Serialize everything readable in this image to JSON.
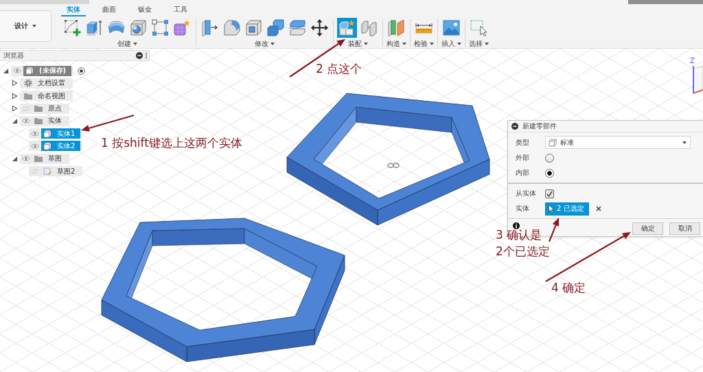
{
  "toolbar": {
    "workspace": "设计",
    "tabs": [
      {
        "label": "实体",
        "selected": true
      },
      {
        "label": "曲面",
        "selected": false
      },
      {
        "label": "钣金",
        "selected": false
      },
      {
        "label": "工具",
        "selected": false
      }
    ],
    "groups": [
      {
        "label": "创建",
        "tools": [
          {
            "kind": "sketch",
            "selected": false
          },
          {
            "kind": "extrude",
            "selected": false
          },
          {
            "kind": "revolve",
            "selected": false
          },
          {
            "kind": "hole",
            "selected": false
          },
          {
            "kind": "pattern",
            "selected": false
          },
          {
            "kind": "form",
            "selected": false
          }
        ]
      },
      {
        "label": "修改",
        "tools": [
          {
            "kind": "press_pull",
            "selected": false
          },
          {
            "kind": "fillet",
            "selected": false
          },
          {
            "kind": "shell",
            "selected": false
          },
          {
            "kind": "combine",
            "selected": false
          },
          {
            "kind": "offset",
            "selected": false
          },
          {
            "kind": "move",
            "selected": false
          }
        ]
      },
      {
        "label": "装配",
        "tools": [
          {
            "kind": "new_component",
            "selected": true
          },
          {
            "kind": "joint",
            "selected": false
          }
        ]
      },
      {
        "label": "构造",
        "tools": [
          {
            "kind": "plane",
            "selected": false
          }
        ]
      },
      {
        "label": "检验",
        "tools": [
          {
            "kind": "measure",
            "selected": false
          }
        ]
      },
      {
        "label": "插入",
        "tools": [
          {
            "kind": "image",
            "selected": false
          }
        ]
      },
      {
        "label": "选择",
        "tools": [
          {
            "kind": "select",
            "selected": false
          }
        ]
      }
    ]
  },
  "browser": {
    "title": "浏览器",
    "root": {
      "label": "(未保存)",
      "kind": "component",
      "active": true,
      "expanded": true,
      "visible": true,
      "selected": false,
      "children": [
        {
          "label": "文档设置",
          "kind": "settings",
          "expanded": false,
          "selected": false
        },
        {
          "label": "命名视图",
          "kind": "folder",
          "expanded": false,
          "selected": false
        },
        {
          "label": "原点",
          "kind": "folder",
          "expanded": false,
          "visible": false,
          "selected": false
        },
        {
          "label": "实体",
          "kind": "folder",
          "expanded": true,
          "visible": true,
          "selected": false,
          "children": [
            {
              "label": "实体1",
              "kind": "body",
              "visible": true,
              "selected": true
            },
            {
              "label": "实体2",
              "kind": "body",
              "visible": true,
              "selected": true
            }
          ]
        },
        {
          "label": "草图",
          "kind": "folder",
          "expanded": true,
          "visible": true,
          "selected": false,
          "children": [
            {
              "label": "草图2",
              "kind": "sketch",
              "visible": false,
              "selected": false
            }
          ]
        }
      ]
    }
  },
  "dialog": {
    "title": "新建零部件",
    "sections": [
      {
        "fields": [
          {
            "kind": "dropdown",
            "label": "类型",
            "value": "标准"
          },
          {
            "kind": "radio",
            "label": "外部",
            "selected": false
          },
          {
            "kind": "radio",
            "label": "内部",
            "selected": true
          }
        ]
      },
      {
        "fields": [
          {
            "kind": "checkbox",
            "label": "从实体",
            "checked": true
          },
          {
            "kind": "selection",
            "label": "实体",
            "value": "2 已选定"
          }
        ]
      }
    ],
    "buttons": [
      "确定",
      "取消"
    ]
  },
  "annotations": [
    {
      "text": "2 点这个"
    },
    {
      "text": "1 按shift键选上这两个实体"
    },
    {
      "text": "3 确认是\n2个已选定"
    },
    {
      "text": "4 确定"
    }
  ],
  "view_cube": {
    "axis_label": "Z"
  }
}
